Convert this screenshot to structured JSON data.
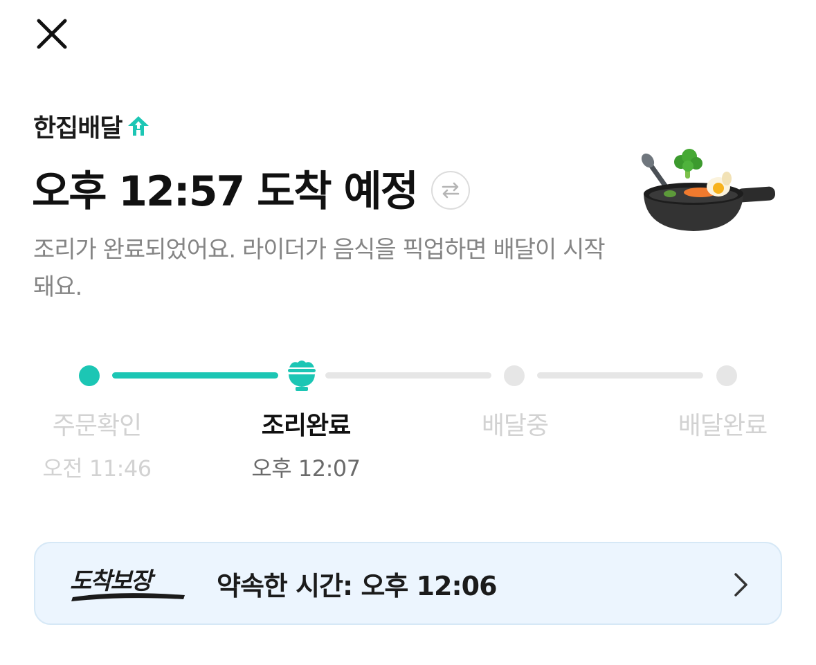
{
  "header": {
    "close_icon": "close-icon"
  },
  "service": {
    "label": "한집배달",
    "icon": "house-arrow-icon",
    "accent_color": "#1cc6b4"
  },
  "eta": {
    "title": "오후 12:57 도착 예정",
    "swap_icon": "swap-arrows-icon"
  },
  "status": {
    "description": "조리가 완료되었어요. 라이더가 음식을 픽업하면 배달이 시작돼요."
  },
  "illustration": {
    "icon": "frying-pan-food-icon"
  },
  "progress": {
    "current_step_index": 1,
    "steps": [
      {
        "label": "주문확인",
        "time": "오전 11:46",
        "state": "done"
      },
      {
        "label": "조리완료",
        "time": "오후 12:07",
        "state": "current"
      },
      {
        "label": "배달중",
        "time": "",
        "state": "pending"
      },
      {
        "label": "배달완료",
        "time": "",
        "state": "pending"
      }
    ],
    "colors": {
      "active": "#1cc6b4",
      "inactive": "#e6e6e6"
    }
  },
  "guarantee": {
    "logo_text": "도착보장",
    "text": "약속한 시간: 오후 12:06",
    "chevron_icon": "chevron-right-icon",
    "background": "#ecf5fe"
  }
}
